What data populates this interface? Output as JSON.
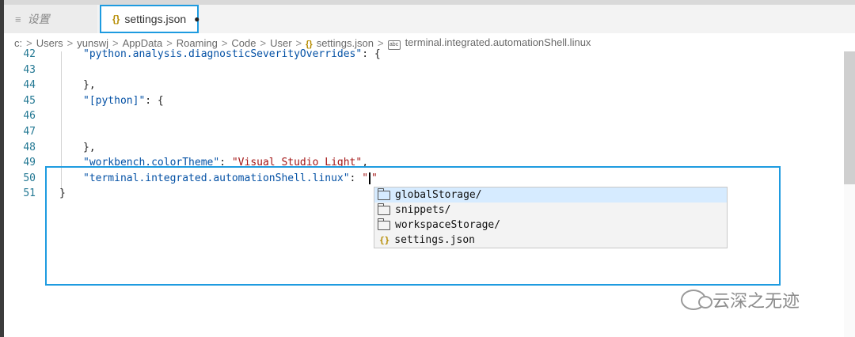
{
  "tabs": [
    {
      "icon": "settings-lines-icon",
      "label": "设置"
    },
    {
      "icon": "json-braces-icon",
      "label": "settings.json",
      "dirty_marker": "●"
    }
  ],
  "breadcrumb": [
    "c:",
    "Users",
    "yunswj",
    "AppData",
    "Roaming",
    "Code",
    "User",
    "settings.json",
    "terminal.integrated.automationShell.linux"
  ],
  "breadcrumb_separator": ">",
  "breadcrumb_json_icon": "{}",
  "breadcrumb_prop_icon": "abc",
  "code": {
    "lines": [
      {
        "num": "42",
        "parts": [
          {
            "t": "key",
            "v": "\"python.analysis.diagnosticSeverityOverrides\""
          },
          {
            "t": "pun",
            "v": ": {"
          }
        ]
      },
      {
        "num": "43",
        "parts": []
      },
      {
        "num": "44",
        "parts": [
          {
            "t": "pun",
            "v": "},"
          }
        ]
      },
      {
        "num": "45",
        "parts": [
          {
            "t": "key",
            "v": "\"[python]\""
          },
          {
            "t": "pun",
            "v": ": {"
          }
        ]
      },
      {
        "num": "46",
        "parts": []
      },
      {
        "num": "47",
        "parts": []
      },
      {
        "num": "48",
        "parts": [
          {
            "t": "pun",
            "v": "},"
          }
        ]
      },
      {
        "num": "49",
        "parts": [
          {
            "t": "key",
            "v": "\"workbench.colorTheme\""
          },
          {
            "t": "pun",
            "v": ": "
          },
          {
            "t": "str",
            "v": "\"Visual Studio Light\""
          },
          {
            "t": "pun",
            "v": ","
          }
        ]
      },
      {
        "num": "50",
        "parts": [
          {
            "t": "key",
            "v": "\"terminal.integrated.automationShell.linux\""
          },
          {
            "t": "pun",
            "v": ": "
          },
          {
            "t": "str",
            "v": "\""
          },
          {
            "t": "cursor",
            "v": ""
          },
          {
            "t": "str",
            "v": "\""
          }
        ]
      },
      {
        "num": "51",
        "parts": [
          {
            "t": "pun",
            "v": "}"
          }
        ]
      }
    ],
    "indent_levels": [
      1,
      0,
      1,
      1,
      0,
      0,
      1,
      1,
      1,
      0
    ]
  },
  "suggestions": [
    {
      "icon": "folder-icon",
      "label": "globalStorage/",
      "selected": true
    },
    {
      "icon": "folder-icon",
      "label": "snippets/",
      "selected": false
    },
    {
      "icon": "folder-icon",
      "label": "workspaceStorage/",
      "selected": false
    },
    {
      "icon": "json-file-icon",
      "label": "settings.json",
      "selected": false
    }
  ],
  "file_icon_glyph": "{}",
  "watermark": "云深之无迹",
  "colors": {
    "accent": "#1e9be0",
    "key": "#0451a5",
    "string": "#a31515",
    "line_number": "#237893",
    "selection": "#d6ebff"
  }
}
